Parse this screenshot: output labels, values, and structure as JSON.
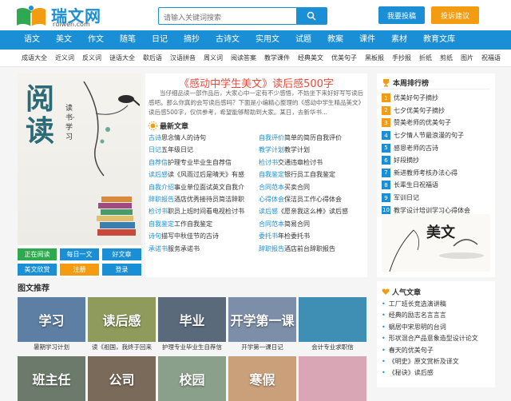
{
  "brand": {
    "name": "瑞文网",
    "sub": "ruiwen.com"
  },
  "search": {
    "placeholder": "请输入关键词搜索"
  },
  "header": {
    "submit": "我要投稿",
    "feedback": "投诉建议"
  },
  "nav": [
    "语文",
    "美文",
    "作文",
    "随笔",
    "日记",
    "摘抄",
    "古诗文",
    "实用文",
    "试题",
    "教案",
    "课件",
    "素材",
    "教育文库"
  ],
  "subnav": [
    "成语大全",
    "近义词",
    "反义词",
    "谜语大全",
    "歇后语",
    "汉语拼音",
    "周义词",
    "阅读答案",
    "教学课件",
    "经典美文",
    "优美句子",
    "黑板报",
    "手抄报",
    "折纸",
    "剪纸",
    "图片",
    "祝福语"
  ],
  "hero": {
    "title": "阅读",
    "vertical": "读书·学习"
  },
  "tags": [
    "正在阅读",
    "每日一文",
    "好文章",
    "美文欣赏",
    "注册",
    "登录"
  ],
  "headline": "《感动中学生美文》读后感500字",
  "summary": "当仔细品读一部作品后，大家心中一定有不少感悟，不妨坐下来好好写写读后感吧。那么你真的会写读后感吗？下面是小编精心整理的《感动中学生精品美文》读后感500字，仅供参考，希望能够帮助到大家。某日，去新华书...",
  "latest": {
    "title": "最新文章",
    "items": [
      {
        "cat": "古诗",
        "text": "思念情人的诗句"
      },
      {
        "cat": "自我评价",
        "text": "简单的简历自我评价"
      },
      {
        "cat": "日记",
        "text": "五年级日记"
      },
      {
        "cat": "教学计划",
        "text": "教学计划"
      },
      {
        "cat": "自荐信",
        "text": "护理专业毕业生自荐信"
      },
      {
        "cat": "检讨书",
        "text": "交通违章检讨书"
      },
      {
        "cat": "读后感",
        "text": "读《风雨过后是晴天》有感"
      },
      {
        "cat": "自我鉴定",
        "text": "银行员工自我鉴定"
      },
      {
        "cat": "自我介绍",
        "text": "事业单位面试英文自我介"
      },
      {
        "cat": "合同范本",
        "text": "买卖合同"
      },
      {
        "cat": "辞职报告",
        "text": "酒店优秀接待员简洁辞职"
      },
      {
        "cat": "心得体会",
        "text": "保洁员工作心得体会"
      },
      {
        "cat": "检讨书",
        "text": "职员上班时间看电视检讨书"
      },
      {
        "cat": "读后感",
        "text": "《愿亲我这么棒》读后感"
      },
      {
        "cat": "自我鉴定",
        "text": "工作自我鉴定"
      },
      {
        "cat": "合同范本",
        "text": "简易合同"
      },
      {
        "cat": "诗句",
        "text": "描写中秋佳节的古诗"
      },
      {
        "cat": "委托书",
        "text": "年检委托书"
      },
      {
        "cat": "承诺书",
        "text": "服务承诺书"
      },
      {
        "cat": "辞职报告",
        "text": "酒店前台辞职报告"
      }
    ]
  },
  "rank": {
    "title": "本周排行榜",
    "items": [
      "优美好句子摘抄",
      "七夕优美句子摘抄",
      "赞美老师的优美句子",
      "七夕情人节最浪漫的句子",
      "感恩老师的古诗",
      "好段摘抄",
      "新进教师考核办法心得",
      "长辈生日祝福语",
      "军训日记",
      "教学设计培训学习心得体会"
    ]
  },
  "ad": {
    "text": "美文"
  },
  "photo_section": {
    "title": "图文推荐",
    "items": [
      {
        "label": "学习",
        "cap": "暑期学习计划",
        "color": "#5d7fa3"
      },
      {
        "label": "读后感",
        "cap": "读《祖国，我终于回来",
        "color": "#8f9b5c"
      },
      {
        "label": "毕业",
        "cap": "护理专业毕业生自荐信",
        "color": "#5a6a7a"
      },
      {
        "label": "开学第一课",
        "cap": "开学第一课日记",
        "color": "#7d8fa8"
      },
      {
        "label": "",
        "cap": "会计专业求职信",
        "color": "#3f8fb5"
      },
      {
        "label": "班主任",
        "cap": "",
        "color": "#6c7a6b"
      },
      {
        "label": "公司",
        "cap": "",
        "color": "#7a6a5a"
      },
      {
        "label": "校园",
        "cap": "",
        "color": "#8aa08a"
      },
      {
        "label": "寒假",
        "cap": "",
        "color": "#c9a07a"
      },
      {
        "label": "",
        "cap": "",
        "color": "#d9a6b6"
      }
    ]
  },
  "popular": {
    "title": "人气文章",
    "items": [
      "工厂班长竞选演讲稿",
      "经典的励志名言言言",
      "蜗居中宋思明的台词",
      "形状混合产品意象造型设计论文",
      "春天的优美句子",
      "《明史》原文赏析及译文",
      "《秘诀》读后感"
    ]
  }
}
